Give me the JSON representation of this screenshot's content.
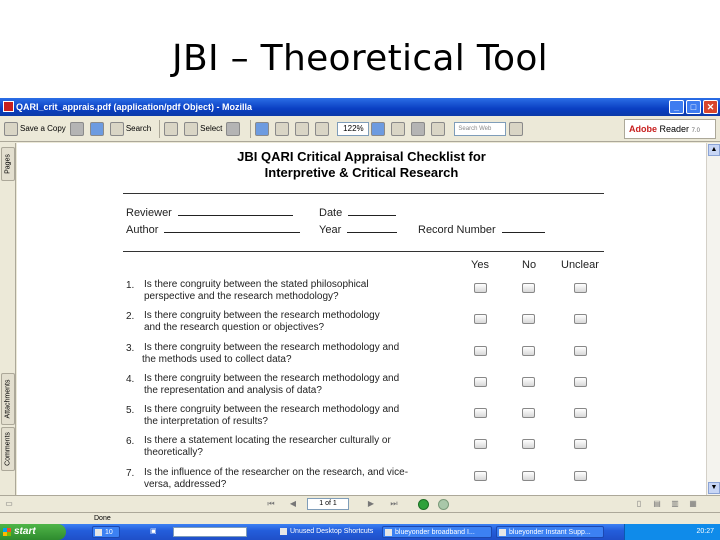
{
  "slide": {
    "title": "JBI – Theoretical Tool"
  },
  "window": {
    "title": "QARI_crit_apprais.pdf (application/pdf Object) - Mozilla",
    "buttons": {
      "minimize": "_",
      "maximize": "□",
      "close": "✕"
    }
  },
  "toolbar": {
    "save_copy": "Save a Copy",
    "search": "Search",
    "select": "Select",
    "zoom": "122%",
    "search_web_placeholder": "Search Web",
    "adobe_brand": "Adobe",
    "adobe_product": "Reader",
    "adobe_version": "7.0"
  },
  "sidetabs": {
    "pages": "Pages",
    "attachments": "Attachments",
    "comments": "Comments"
  },
  "document": {
    "title_line1": "JBI QARI Critical Appraisal Checklist for",
    "title_line2": "Interpretive & Critical Research",
    "fields": {
      "reviewer": "Reviewer",
      "date": "Date",
      "author": "Author",
      "year": "Year",
      "record_number": "Record Number"
    },
    "columns": {
      "yes": "Yes",
      "no": "No",
      "unclear": "Unclear"
    },
    "questions": [
      {
        "num": "1.",
        "line1": "Is there congruity between the stated philosophical",
        "line2": "perspective and the research methodology?"
      },
      {
        "num": "2.",
        "line1": "Is there congruity between the research methodology",
        "line2": "and the research question or objectives?"
      },
      {
        "num": "3.",
        "line1": "Is there congruity between the research methodology and",
        "line2": "the methods used to collect data?"
      },
      {
        "num": "4.",
        "line1": "Is there congruity between the research methodology and",
        "line2": "the representation and analysis of data?"
      },
      {
        "num": "5.",
        "line1": "Is there congruity between the research methodology and",
        "line2": "the interpretation of results?"
      },
      {
        "num": "6.",
        "line1": "Is there a statement locating the researcher culturally or",
        "line2": "theoretically?"
      },
      {
        "num": "7.",
        "line1": "Is the influence of the researcher on the research, and vice-",
        "line2": "versa, addressed?"
      }
    ]
  },
  "navigation": {
    "page": "1 of 1"
  },
  "status": {
    "text": "Done"
  },
  "taskbar": {
    "start": "start",
    "count": "10",
    "tasks": [
      "Unused Desktop Shortcuts",
      "blueyonder broadband I...",
      "blueyonder Instant Supp..."
    ],
    "clock": "20:27"
  }
}
